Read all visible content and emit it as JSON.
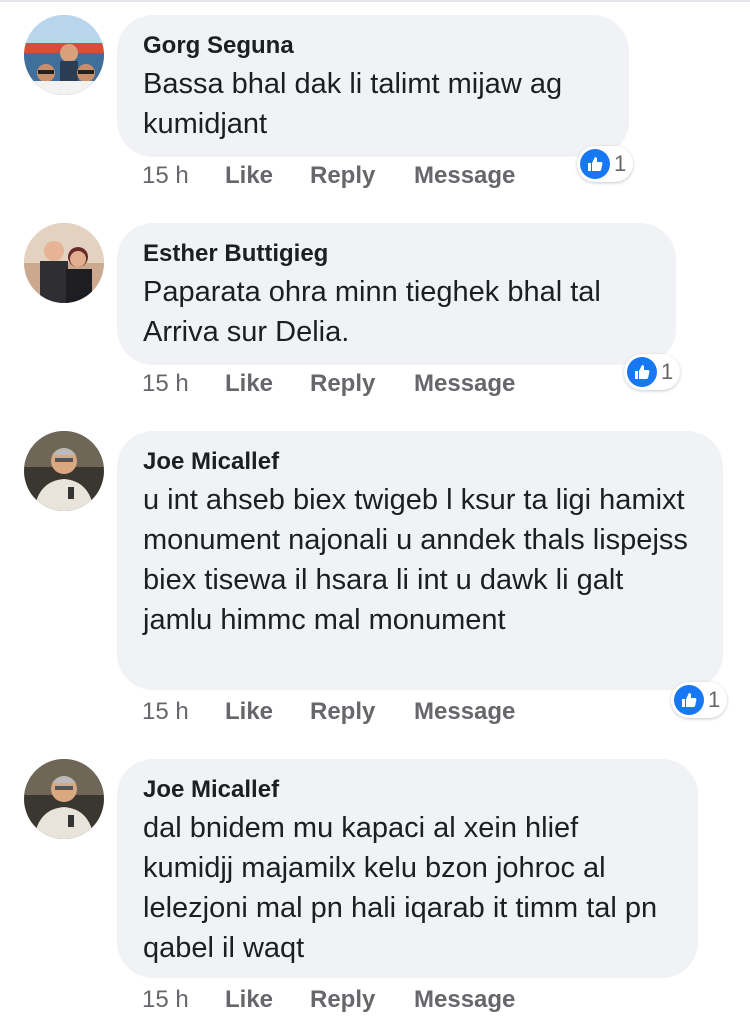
{
  "colors": {
    "bubble": "#f0f2f5",
    "reaction_blue": "#1877f2",
    "meta_text": "#65676b",
    "body_text": "#1c1e21"
  },
  "comments": [
    {
      "author": "Gorg Seguna",
      "text": "Bassa bhal dak li talimt mijaw ag kumidjant",
      "time": "15 h",
      "like": "Like",
      "reply": "Reply",
      "message": "Message",
      "reaction_icon": "thumbs-up-icon",
      "reaction_count": "1"
    },
    {
      "author": "Esther Buttigieg",
      "text": "Paparata ohra minn tieghek bhal tal Arriva sur Delia.",
      "time": "15 h",
      "like": "Like",
      "reply": "Reply",
      "message": "Message",
      "reaction_icon": "thumbs-up-icon",
      "reaction_count": "1"
    },
    {
      "author": "Joe Micallef",
      "text": "u int ahseb biex twigeb l ksur ta ligi hamixt monument najonali u anndek thals lispejss biex tisewa il hsara li int u dawk li galt jamlu himmc mal monument",
      "time": "15 h",
      "like": "Like",
      "reply": "Reply",
      "message": "Message",
      "reaction_icon": "thumbs-up-icon",
      "reaction_count": "1"
    },
    {
      "author": "Joe Micallef",
      "text": "dal bnidem mu kapaci al xein hlief kumidjj majamilx kelu bzon johroc al lelezjoni mal pn hali iqarab it timm tal pn qabel il waqt",
      "time": "15 h",
      "like": "Like",
      "reply": "Reply",
      "message": "Message"
    }
  ]
}
